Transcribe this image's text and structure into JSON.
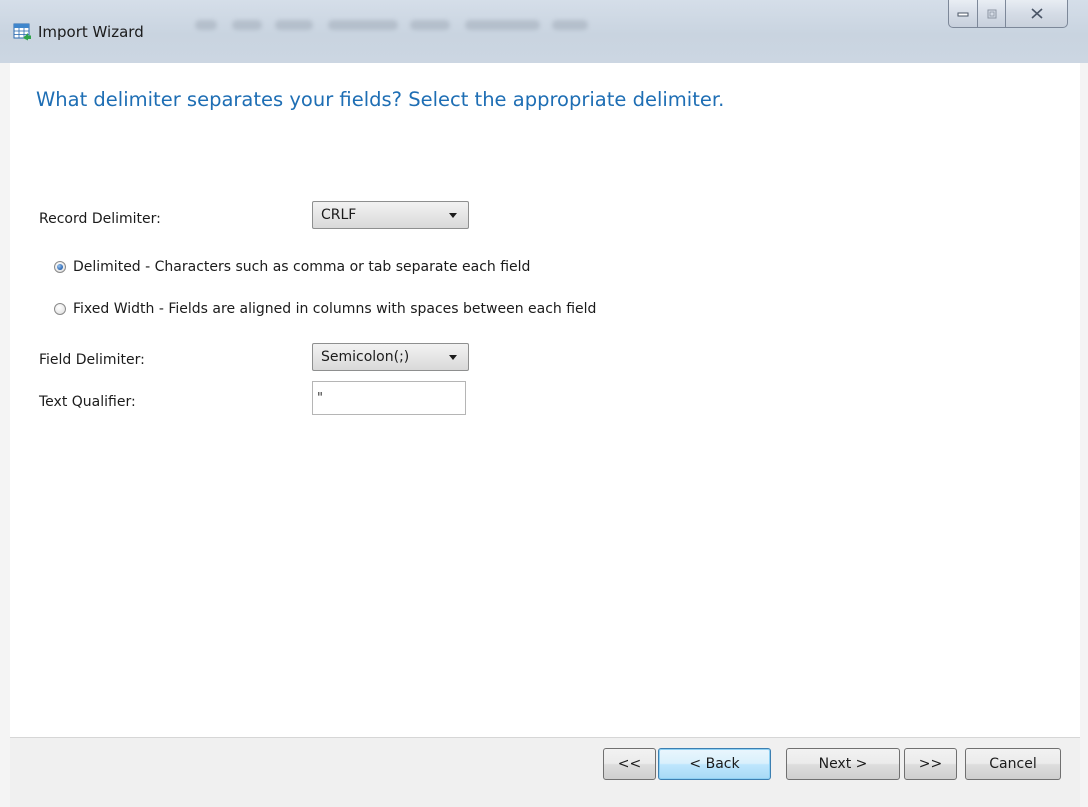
{
  "window": {
    "title": "Import Wizard"
  },
  "page": {
    "heading": "What delimiter separates your fields? Select the appropriate delimiter."
  },
  "record_delimiter": {
    "label": "Record Delimiter:",
    "value": "CRLF"
  },
  "format_options": [
    {
      "label": "Delimited - Characters such as comma or tab separate each field",
      "checked": true
    },
    {
      "label": "Fixed Width - Fields are aligned in columns with spaces between each field",
      "checked": false
    }
  ],
  "field_delimiter": {
    "label": "Field Delimiter:",
    "value": "Semicolon(;)"
  },
  "text_qualifier": {
    "label": "Text Qualifier:",
    "value": "\""
  },
  "buttons": {
    "first": "<<",
    "back": "< Back",
    "next": "Next >",
    "last": ">>",
    "cancel": "Cancel"
  },
  "colors": {
    "heading": "#1e6eb4",
    "default_button_border": "#3c7fb1"
  }
}
